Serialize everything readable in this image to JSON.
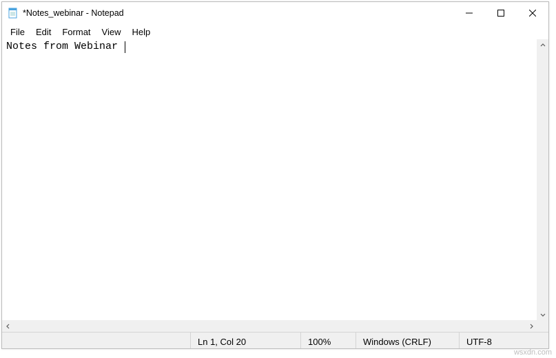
{
  "titlebar": {
    "title": "*Notes_webinar - Notepad"
  },
  "menubar": {
    "items": [
      "File",
      "Edit",
      "Format",
      "View",
      "Help"
    ]
  },
  "editor": {
    "content": "Notes from Webinar "
  },
  "statusbar": {
    "position": "Ln 1, Col 20",
    "zoom": "100%",
    "eol": "Windows (CRLF)",
    "encoding": "UTF-8"
  },
  "watermark": "wsxdn.com"
}
